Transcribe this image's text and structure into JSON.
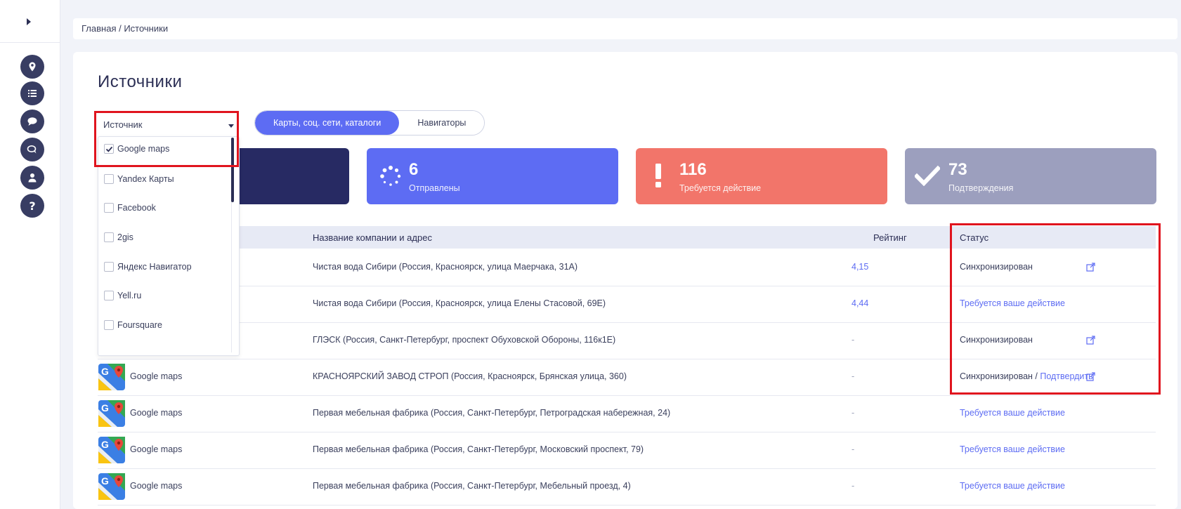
{
  "breadcrumb": "Главная / Источники",
  "page_title": "Источники",
  "tabs": [
    {
      "label": "Карты, соц. сети, каталоги",
      "active": true
    },
    {
      "label": "Навигаторы",
      "active": false
    }
  ],
  "stats": [
    {
      "value": "",
      "label": "",
      "color": "#272a63"
    },
    {
      "value": "6",
      "label": "Отправлены",
      "color": "#5d6cf3",
      "icon": "spinner-icon"
    },
    {
      "value": "116",
      "label": "Требуется действие",
      "color": "#f2756a",
      "icon": "exclamation-icon"
    },
    {
      "value": "73",
      "label": "Подтверждения",
      "color": "#9c9fbe",
      "icon": "check-icon"
    }
  ],
  "filter": {
    "label": "Источник",
    "options": [
      {
        "label": "Google maps",
        "checked": true
      },
      {
        "label": "Yandex Карты",
        "checked": false
      },
      {
        "label": "Facebook",
        "checked": false
      },
      {
        "label": "2gis",
        "checked": false
      },
      {
        "label": "Яндекс Навигатор",
        "checked": false
      },
      {
        "label": "Yell.ru",
        "checked": false
      },
      {
        "label": "Foursquare",
        "checked": false
      }
    ]
  },
  "table": {
    "headers": {
      "name": "Название компании и адрес",
      "rating": "Рейтинг",
      "status": "Статус"
    },
    "rows": [
      {
        "source": "",
        "name": "Чистая вода Сибири (Россия, Красноярск, улица Маерчака, 31А)",
        "rating": "4,15",
        "status": "Синхронизирован",
        "status_link": "",
        "ext": true
      },
      {
        "source": "",
        "name": "Чистая вода Сибири (Россия, Красноярск, улица Елены Стасовой, 69Е)",
        "rating": "4,44",
        "status": "",
        "status_link": "Требуется ваше действие",
        "ext": false
      },
      {
        "source": "",
        "name": "ГЛЭСК (Россия, Санкт-Петербург, проспект Обуховской Обороны, 116к1Е)",
        "rating": "-",
        "status": "Синхронизирован",
        "status_link": "",
        "ext": true
      },
      {
        "source": "Google maps",
        "name": "КРАСНОЯРСКИЙ ЗАВОД СТРОП (Россия, Красноярск, Брянская улица, 360)",
        "rating": "-",
        "status": "Синхронизирован / ",
        "status_link": "Подтвердить",
        "ext": true
      },
      {
        "source": "Google maps",
        "name": "Первая мебельная фабрика (Россия, Санкт-Петербург, Петроградская набережная, 24)",
        "rating": "-",
        "status": "",
        "status_link": "Требуется ваше действие",
        "ext": false
      },
      {
        "source": "Google maps",
        "name": "Первая мебельная фабрика (Россия, Санкт-Петербург, Московский проспект, 79)",
        "rating": "-",
        "status": "",
        "status_link": "Требуется ваше действие",
        "ext": false
      },
      {
        "source": "Google maps",
        "name": "Первая мебельная фабрика (Россия, Санкт-Петербург, Мебельный проезд, 4)",
        "rating": "-",
        "status": "",
        "status_link": "Требуется ваше действие",
        "ext": false
      }
    ]
  },
  "sidebar_icons": [
    "map-pin-icon",
    "list-icon",
    "comment-icon",
    "chat-icon",
    "user-icon",
    "help-icon"
  ],
  "help_glyph": "?"
}
